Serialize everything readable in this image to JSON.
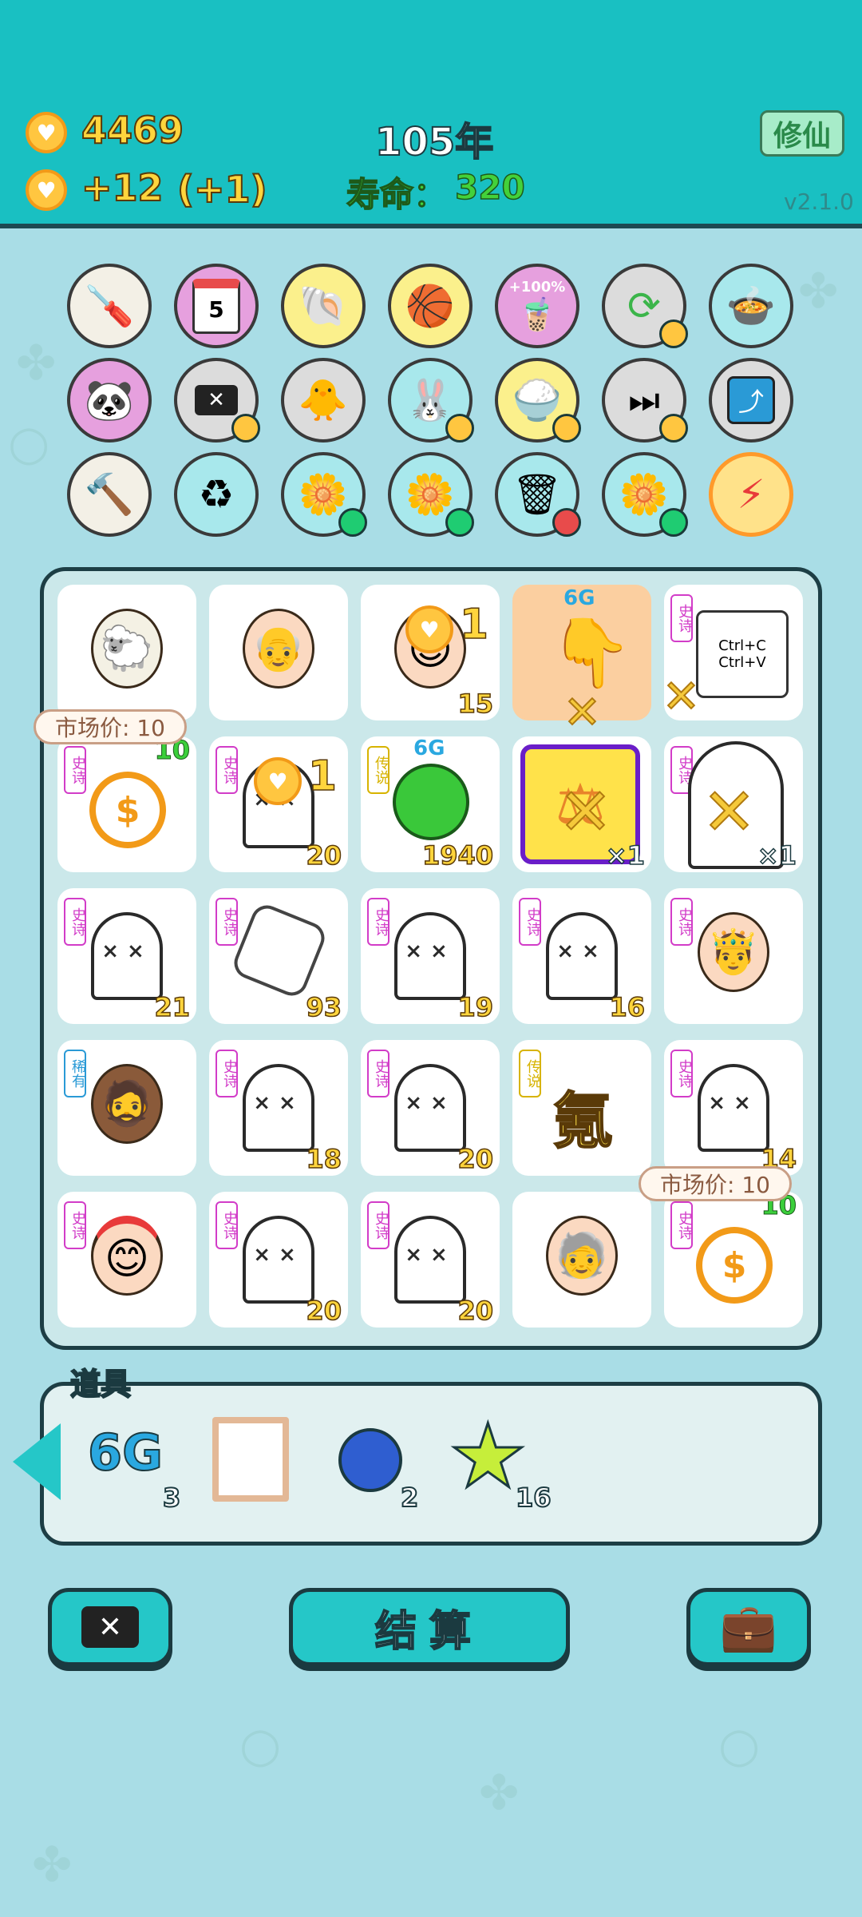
{
  "status": {
    "coins": "4469",
    "income": "+12",
    "income_bonus": "(+1)",
    "year": "105年",
    "lifespan_label": "寿命：",
    "lifespan_value": "320",
    "cultivate_button": "修仙",
    "version": "v2.1.0"
  },
  "skills_row1": [
    "screwdriver-icon",
    "calendar-icon",
    "shell-icon",
    "basketballs-icon",
    "cup-icon",
    "refresh-icon",
    "rice-cooker-icon"
  ],
  "calendar_day": "5",
  "cup_label": "+100%",
  "board": {
    "cells": [
      {
        "badge": "",
        "count": ""
      },
      {
        "badge": "",
        "count": ""
      },
      {
        "badge": "",
        "count": "15",
        "overlay": "1"
      },
      {
        "badge": "",
        "count": "",
        "top": "6G"
      },
      {
        "badge": "史诗",
        "count": "",
        "copy1": "Ctrl+C",
        "copy2": "Ctrl+V"
      },
      {
        "badge": "史诗",
        "count": "10"
      },
      {
        "badge": "史诗",
        "count": "20",
        "overlay": "1"
      },
      {
        "badge": "传说",
        "count": "1940",
        "top": "6G"
      },
      {
        "badge": "",
        "count": "×1"
      },
      {
        "badge": "史诗",
        "count": "×1"
      },
      {
        "badge": "史诗",
        "count": "21"
      },
      {
        "badge": "史诗",
        "count": "93"
      },
      {
        "badge": "史诗",
        "count": "19"
      },
      {
        "badge": "史诗",
        "count": "16"
      },
      {
        "badge": "史诗",
        "count": ""
      },
      {
        "badge": "稀有",
        "count": ""
      },
      {
        "badge": "史诗",
        "count": "18"
      },
      {
        "badge": "史诗",
        "count": "20"
      },
      {
        "badge": "传说",
        "count": "",
        "big": "氪"
      },
      {
        "badge": "史诗",
        "count": "14"
      },
      {
        "badge": "史诗",
        "count": ""
      },
      {
        "badge": "史诗",
        "count": "20"
      },
      {
        "badge": "史诗",
        "count": "20"
      },
      {
        "badge": "",
        "count": ""
      },
      {
        "badge": "史诗",
        "count": "10"
      }
    ],
    "tip1": "市场价: 10",
    "tip2": "市场价: 10"
  },
  "items": {
    "title": "道具",
    "list": [
      {
        "name": "6G",
        "count": "3"
      },
      {
        "name": "frame",
        "count": ""
      },
      {
        "name": "blueberry",
        "count": "2"
      },
      {
        "name": "star",
        "count": "16"
      }
    ]
  },
  "buttons": {
    "settle": "结算"
  },
  "colors": {
    "topbar": "#19c0c2",
    "background": "#a9dde6",
    "gold": "#ffd53d",
    "epic": "#d23cc8",
    "legend": "#d7b300",
    "rare": "#2a9ad6"
  }
}
